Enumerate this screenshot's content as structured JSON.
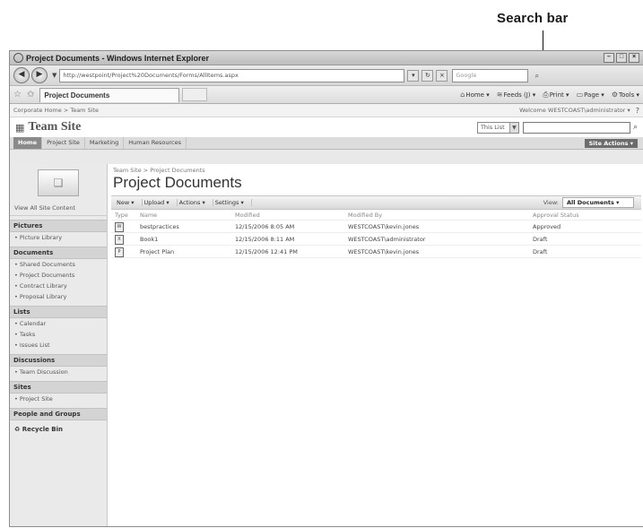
{
  "callout": {
    "label": "Search bar"
  },
  "browser": {
    "window_title": "Project Documents - Windows Internet Explorer",
    "url": "http://westpoint/Project%20Documents/Forms/AllItems.aspx",
    "search_placeholder": "Google",
    "tab_title": "Project Documents",
    "commands": [
      {
        "icon": "home-icon",
        "label": "Home"
      },
      {
        "icon": "feeds-icon",
        "label": "Feeds (J)"
      },
      {
        "icon": "print-icon",
        "label": "Print"
      },
      {
        "icon": "page-icon",
        "label": "Page"
      },
      {
        "icon": "tools-icon",
        "label": "Tools"
      }
    ]
  },
  "sharepoint": {
    "top_breadcrumb": "Corporate Home > Team Site",
    "welcome": "Welcome WESTCOAST\\administrator",
    "site_name": "Team Site",
    "search_scope": "This List",
    "nav_tabs": [
      "Home",
      "Project Site",
      "Marketing",
      "Human Resources"
    ],
    "site_actions": "Site Actions"
  },
  "quick_launch": {
    "view_all": "View All Site Content",
    "sections": [
      {
        "heading": "Pictures",
        "items": [
          "Picture Library"
        ]
      },
      {
        "heading": "Documents",
        "items": [
          "Shared Documents",
          "Project Documents",
          "Contract Library",
          "Proposal Library"
        ]
      },
      {
        "heading": "Lists",
        "items": [
          "Calendar",
          "Tasks",
          "Issues List"
        ]
      },
      {
        "heading": "Discussions",
        "items": [
          "Team Discussion"
        ]
      },
      {
        "heading": "Sites",
        "items": [
          "Project Site"
        ]
      },
      {
        "heading": "People and Groups",
        "items": []
      }
    ],
    "recycle_bin": "Recycle Bin"
  },
  "main": {
    "breadcrumb": "Team Site > Project Documents",
    "title": "Project Documents",
    "toolbar": {
      "new": "New",
      "upload": "Upload",
      "actions": "Actions",
      "settings": "Settings",
      "view_label": "View:",
      "view_value": "All Documents"
    },
    "columns": [
      "Type",
      "Name",
      "Modified",
      "Modified By",
      "Approval Status"
    ],
    "rows": [
      {
        "icon": "word-doc-icon",
        "name": "bestpractices",
        "modified": "12/15/2006 8:05 AM",
        "modified_by": "WESTCOAST\\kevin.jones",
        "status": "Approved"
      },
      {
        "icon": "excel-doc-icon",
        "name": "Book1",
        "modified": "12/15/2006 8:11 AM",
        "modified_by": "WESTCOAST\\administrator",
        "status": "Draft"
      },
      {
        "icon": "project-doc-icon",
        "name": "Project Plan",
        "modified": "12/15/2006 12:41 PM",
        "modified_by": "WESTCOAST\\kevin.jones",
        "status": "Draft"
      }
    ]
  }
}
